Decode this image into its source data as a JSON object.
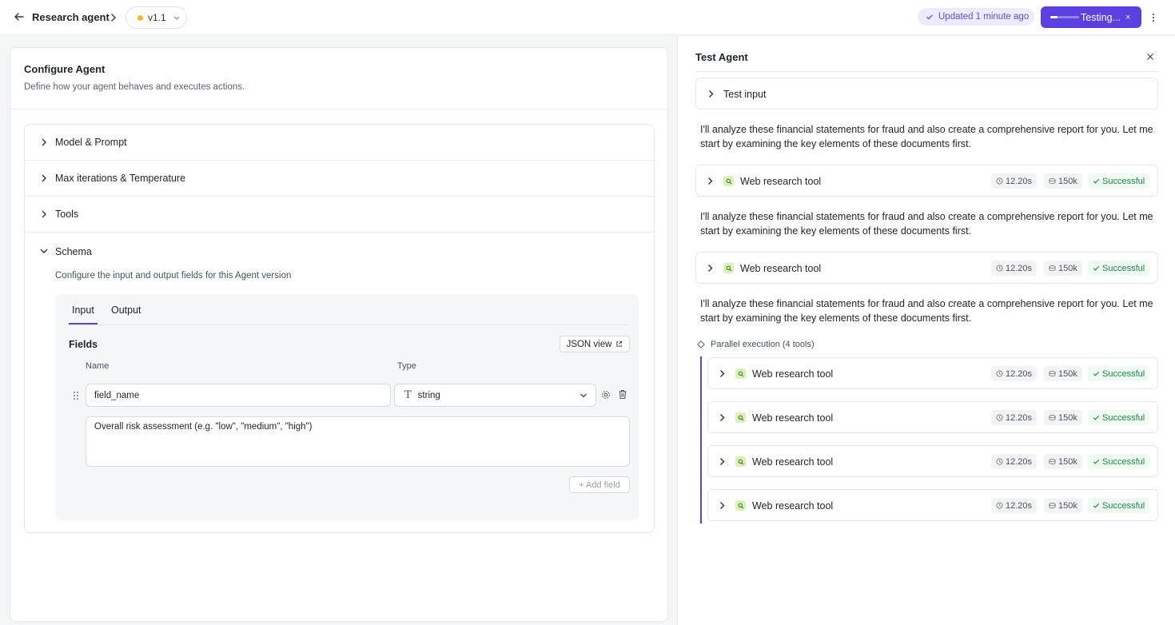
{
  "header": {
    "agent_name": "Research agent",
    "version": "v1.1",
    "updated": "Updated 1 minute ago",
    "testing_label": "Testing...",
    "testing_close": "×"
  },
  "configure": {
    "title": "Configure Agent",
    "subtitle": "Define how your agent behaves and executes actions.",
    "sections": [
      "Model & Prompt",
      "Max iterations & Temperature",
      "Tools",
      "Schema"
    ],
    "schema_subtitle": "Configure the input and output fields for this Agent version",
    "tabs": [
      "Input",
      "Output"
    ],
    "fields_title": "Fields",
    "json_view": "JSON view",
    "col_name": "Name",
    "col_type": "Type",
    "field_name_value": "field_name",
    "field_type_icon": "T",
    "field_type_value": "string",
    "description_value": "Overall risk assessment (e.g. \"low\", \"medium\", \"high\")",
    "add_field": "+ Add field"
  },
  "test_agent": {
    "title": "Test Agent",
    "test_input_label": "Test input",
    "message": "I'll analyze these financial statements for fraud and also create a comprehensive report for you. Let me start by examining the key elements of these documents first.",
    "tool_name": "Web research tool",
    "tool_time": "12.20s",
    "tool_tokens": "150k",
    "tool_status": "Successful",
    "parallel_label": "Parallel execution (4 tools)"
  },
  "colors": {
    "accent": "#5b3fe0",
    "success": "#1f8a48",
    "version_dot": "#f5b72a"
  }
}
